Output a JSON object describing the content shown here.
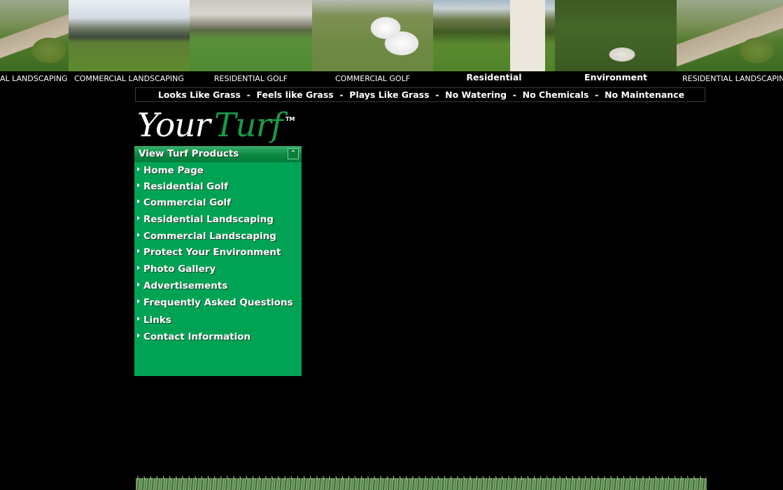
{
  "banner": {
    "tiles": [
      {
        "caption": "AL LANDSCAPING"
      },
      {
        "caption": "COMMERCIAL LANDSCAPING"
      },
      {
        "caption": "RESIDENTIAL GOLF"
      },
      {
        "caption": "COMMERCIAL GOLF"
      },
      {
        "caption": "Residential"
      },
      {
        "caption": "Environment"
      },
      {
        "caption": "RESIDENTIAL LANDSCAPING"
      }
    ]
  },
  "tagline": "Looks Like Grass  -  Feels like Grass  -  Plays Like Grass  -  No Watering  -  No Chemicals  -  No Maintenance",
  "logo": {
    "your": "Your",
    "turf": "Turf",
    "tm": "TM"
  },
  "menu": {
    "header": "View Turf Products",
    "items": [
      {
        "label": "Home Page"
      },
      {
        "label": "Residential Golf"
      },
      {
        "label": "Commercial Golf"
      },
      {
        "label": "Residential Landscaping"
      },
      {
        "label": "Commercial Landscaping"
      },
      {
        "label": "Protect Your Environment"
      },
      {
        "label": "Photo Gallery"
      },
      {
        "label": "Advertisements"
      },
      {
        "label": "Frequently Asked Questions"
      },
      {
        "label": "Links"
      },
      {
        "label": "Contact Information"
      }
    ]
  },
  "colors": {
    "background": "#000000",
    "menu_green": "#00a254",
    "logo_green": "#199a49"
  }
}
